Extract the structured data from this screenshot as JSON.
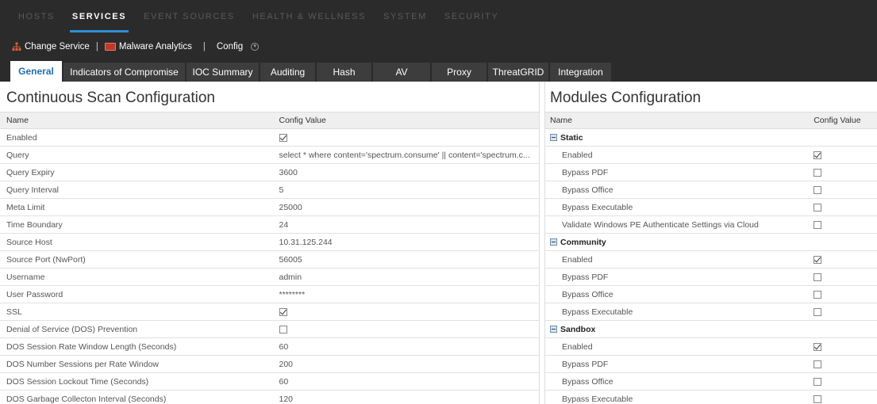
{
  "topnav": {
    "items": [
      {
        "label": "HOSTS",
        "active": false
      },
      {
        "label": "SERVICES",
        "active": true
      },
      {
        "label": "EVENT SOURCES",
        "active": false
      },
      {
        "label": "HEALTH & WELLNESS",
        "active": false
      },
      {
        "label": "SYSTEM",
        "active": false
      },
      {
        "label": "SECURITY",
        "active": false
      }
    ]
  },
  "servicebar": {
    "change_service": "Change Service",
    "service_name": "Malware Analytics",
    "config": "Config"
  },
  "tabs": [
    {
      "label": "General",
      "active": true
    },
    {
      "label": "Indicators of Compromise",
      "active": false
    },
    {
      "label": "IOC Summary",
      "active": false
    },
    {
      "label": "Auditing",
      "active": false
    },
    {
      "label": "Hash",
      "active": false
    },
    {
      "label": "AV",
      "active": false
    },
    {
      "label": "Proxy",
      "active": false
    },
    {
      "label": "ThreatGRID",
      "active": false
    },
    {
      "label": "Integration",
      "active": false
    }
  ],
  "left": {
    "title": "Continuous Scan Configuration",
    "col_name": "Name",
    "col_value": "Config Value",
    "rows": [
      {
        "name": "Enabled",
        "type": "checkbox",
        "checked": true
      },
      {
        "name": "Query",
        "type": "text",
        "value": "select * where content='spectrum.consume' || content='spectrum.c..."
      },
      {
        "name": "Query Expiry",
        "type": "text",
        "value": "3600"
      },
      {
        "name": "Query Interval",
        "type": "text",
        "value": "5"
      },
      {
        "name": "Meta Limit",
        "type": "text",
        "value": "25000"
      },
      {
        "name": "Time Boundary",
        "type": "text",
        "value": "24"
      },
      {
        "name": "Source Host",
        "type": "text",
        "value": "10.31.125.244"
      },
      {
        "name": "Source Port (NwPort)",
        "type": "text",
        "value": "56005"
      },
      {
        "name": "Username",
        "type": "text",
        "value": "admin"
      },
      {
        "name": "User Password",
        "type": "text",
        "value": "********"
      },
      {
        "name": "SSL",
        "type": "checkbox",
        "checked": true
      },
      {
        "name": "Denial of Service (DOS) Prevention",
        "type": "checkbox",
        "checked": false
      },
      {
        "name": "DOS Session Rate Window Length (Seconds)",
        "type": "text",
        "value": "60"
      },
      {
        "name": "DOS Number Sessions per Rate Window",
        "type": "text",
        "value": "200"
      },
      {
        "name": "DOS Session Lockout Time (Seconds)",
        "type": "text",
        "value": "60"
      },
      {
        "name": "DOS Garbage Collecton Interval (Seconds)",
        "type": "text",
        "value": "120"
      }
    ]
  },
  "right": {
    "title": "Modules Configuration",
    "col_name": "Name",
    "col_value": "Config Value",
    "groups": [
      {
        "label": "Static",
        "rows": [
          {
            "name": "Enabled",
            "checked": true
          },
          {
            "name": "Bypass PDF",
            "checked": false
          },
          {
            "name": "Bypass Office",
            "checked": false
          },
          {
            "name": "Bypass Executable",
            "checked": false
          },
          {
            "name": "Validate Windows PE Authenticate Settings via Cloud",
            "checked": false
          }
        ]
      },
      {
        "label": "Community",
        "rows": [
          {
            "name": "Enabled",
            "checked": true
          },
          {
            "name": "Bypass PDF",
            "checked": false
          },
          {
            "name": "Bypass Office",
            "checked": false
          },
          {
            "name": "Bypass Executable",
            "checked": false
          }
        ]
      },
      {
        "label": "Sandbox",
        "rows": [
          {
            "name": "Enabled",
            "checked": true
          },
          {
            "name": "Bypass PDF",
            "checked": false
          },
          {
            "name": "Bypass Office",
            "checked": false
          },
          {
            "name": "Bypass Executable",
            "checked": false
          }
        ]
      }
    ]
  },
  "colors": {
    "accent": "#2d8fd5",
    "tab_active_text": "#1f6fb4",
    "bar_bg": "#2b2b2b"
  }
}
